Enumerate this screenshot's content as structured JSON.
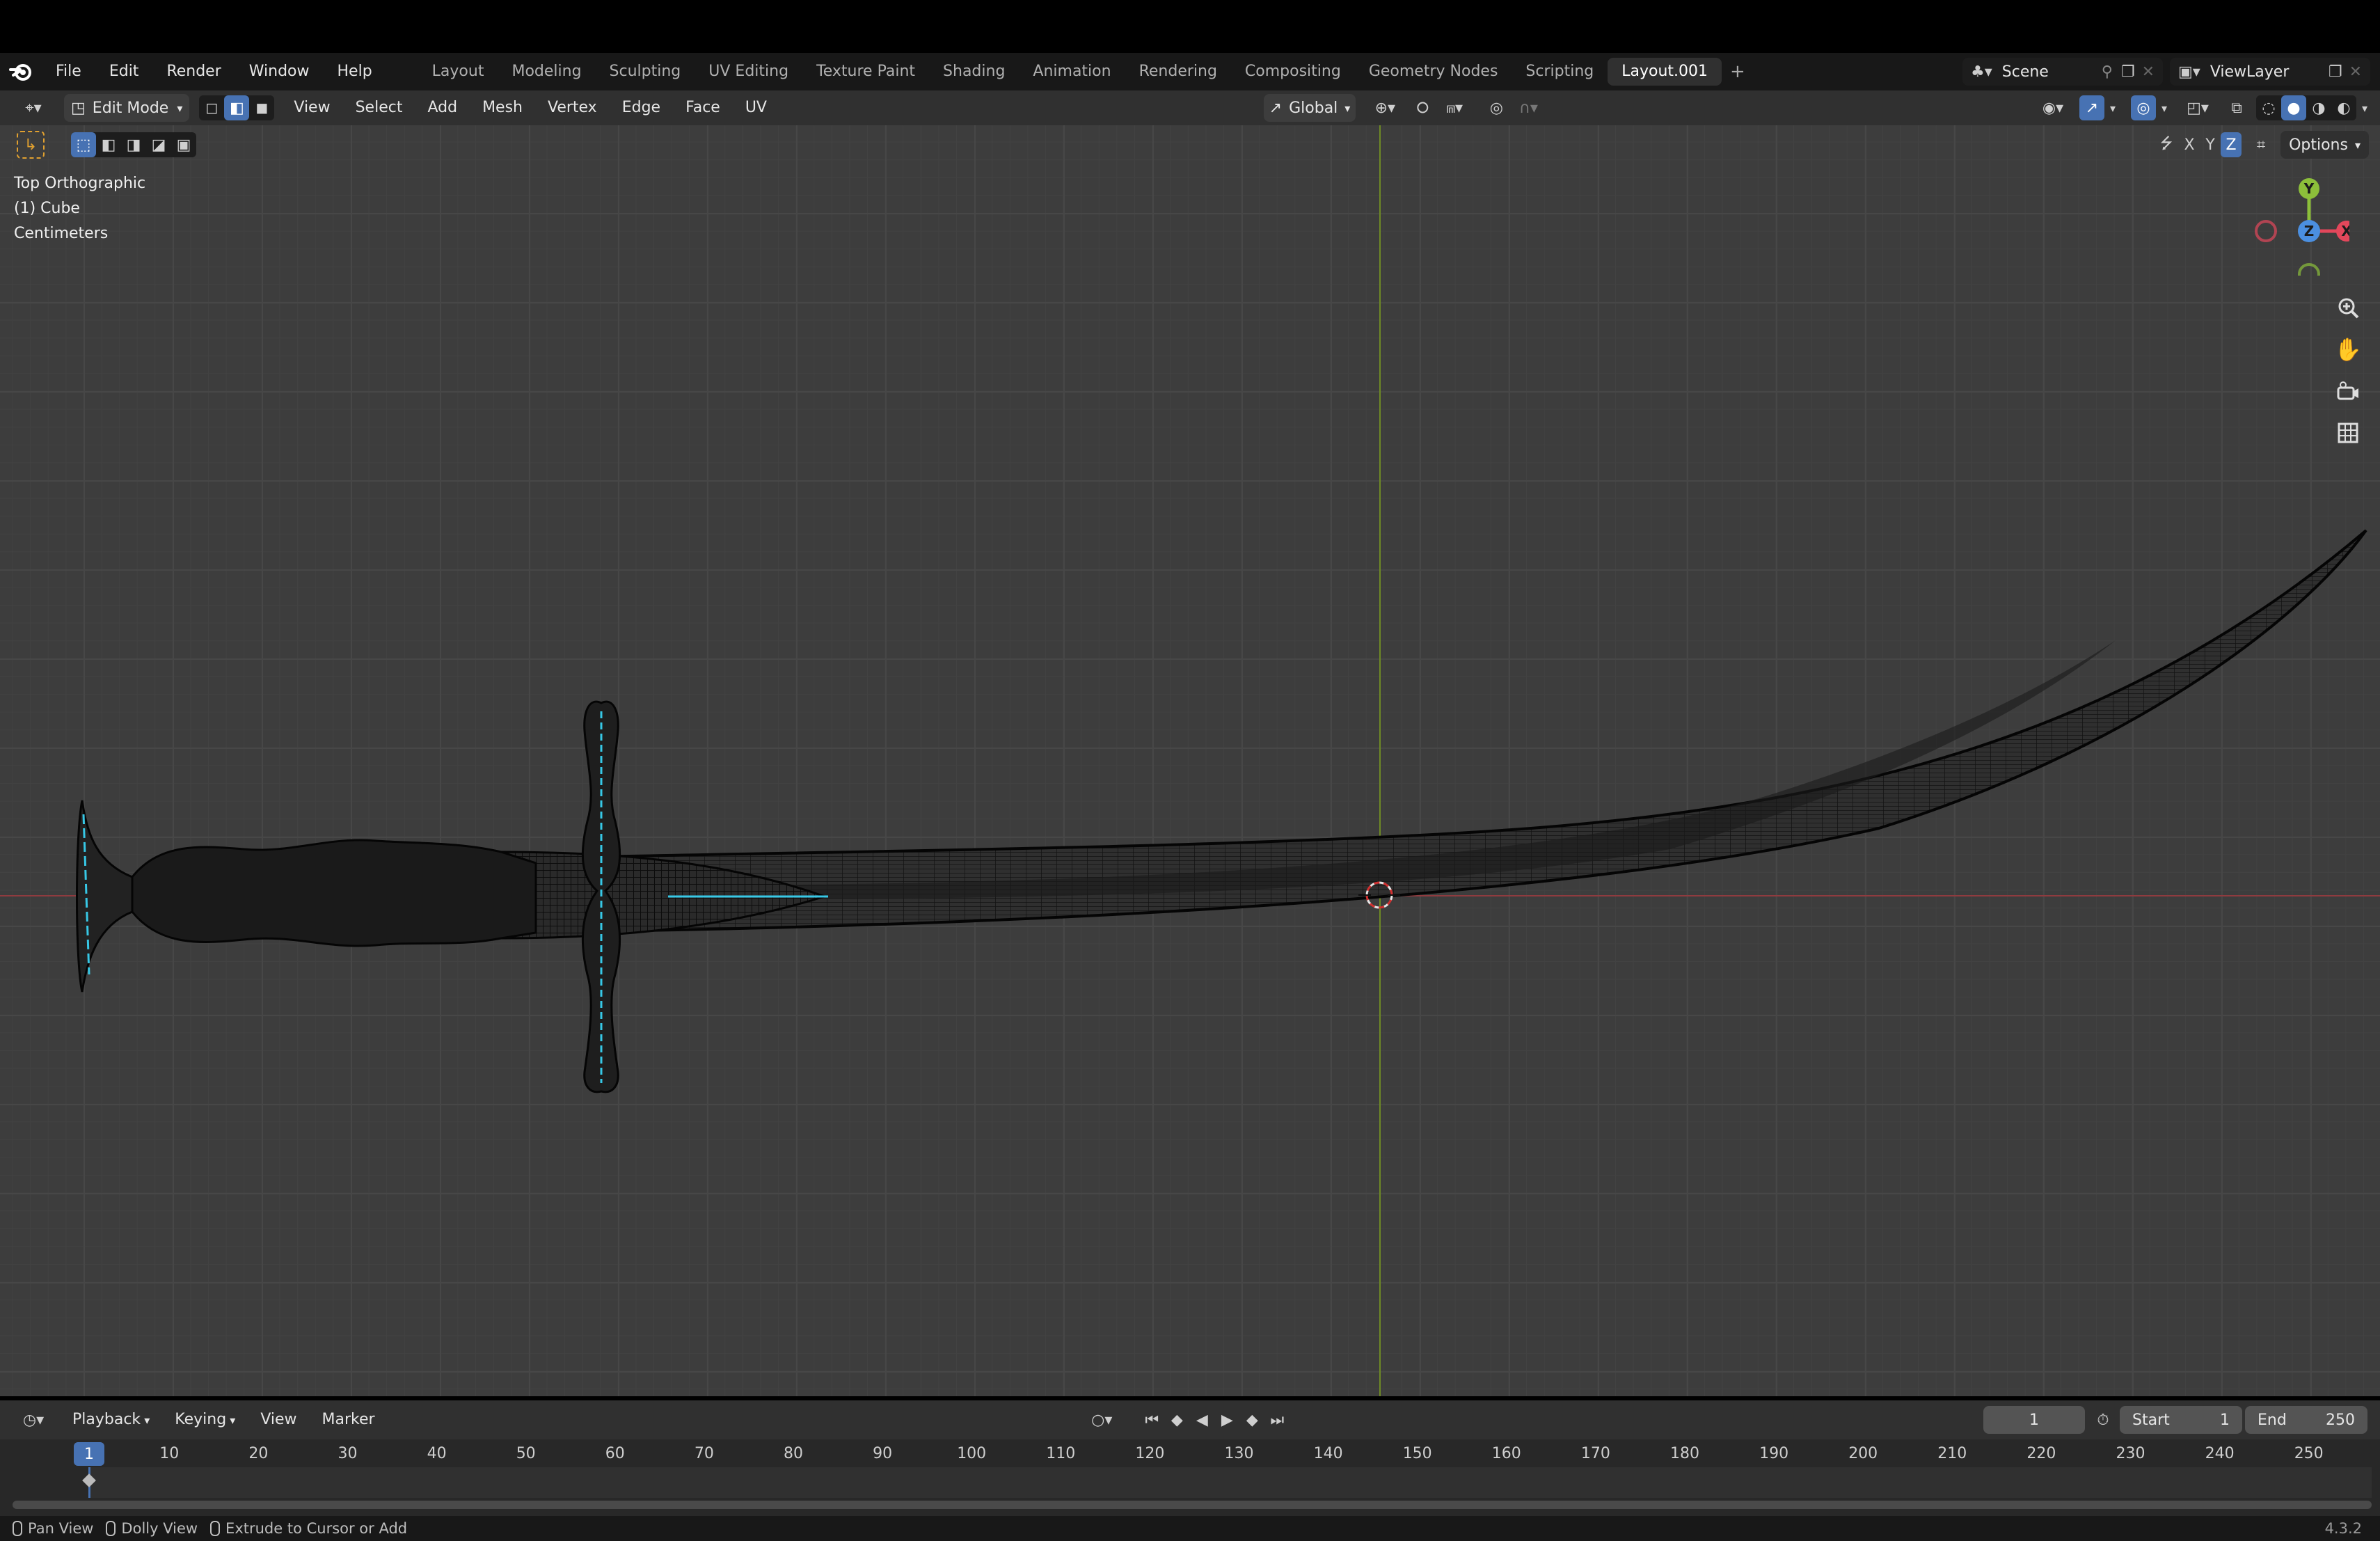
{
  "topbar": {
    "menus": [
      "File",
      "Edit",
      "Render",
      "Window",
      "Help"
    ],
    "workspaces": [
      "Layout",
      "Modeling",
      "Sculpting",
      "UV Editing",
      "Texture Paint",
      "Shading",
      "Animation",
      "Rendering",
      "Compositing",
      "Geometry Nodes",
      "Scripting",
      "Layout.001"
    ],
    "active_workspace": "Layout.001",
    "add_tab_icon": "+",
    "scene_name": "Scene",
    "view_layer": "ViewLayer"
  },
  "header": {
    "mode": "Edit Mode",
    "menus": [
      "View",
      "Select",
      "Add",
      "Mesh",
      "Vertex",
      "Edge",
      "Face",
      "UV"
    ],
    "transform_orientation": "Global",
    "options_label": "Options",
    "axis_x": "X",
    "axis_y": "Y",
    "axis_z": "Z"
  },
  "viewport": {
    "view_name": "Top Orthographic",
    "object_name": "(1) Cube",
    "units": "Centimeters",
    "gizmo_y": "Y",
    "gizmo_z": "Z",
    "gizmo_x": "X"
  },
  "timeline": {
    "menus": [
      "Playback",
      "Keying",
      "View",
      "Marker"
    ],
    "current_frame": "1",
    "start_label": "Start",
    "start_value": "1",
    "end_label": "End",
    "end_value": "250",
    "ticks": [
      "10",
      "20",
      "30",
      "40",
      "50",
      "60",
      "70",
      "80",
      "90",
      "100",
      "110",
      "120",
      "130",
      "140",
      "150",
      "160",
      "170",
      "180",
      "190",
      "200",
      "210",
      "220",
      "230",
      "240",
      "250"
    ],
    "playhead_label": "1"
  },
  "statusbar": {
    "pan": "Pan View",
    "dolly": "Dolly View",
    "extrude": "Extrude to Cursor or Add",
    "version": "4.3.2"
  },
  "colors": {
    "accent": "#4772b3",
    "axis_x": "#e3475b",
    "axis_y": "#8cbf3a",
    "axis_z": "#4b8fe0",
    "selection": "#37c8e6"
  }
}
